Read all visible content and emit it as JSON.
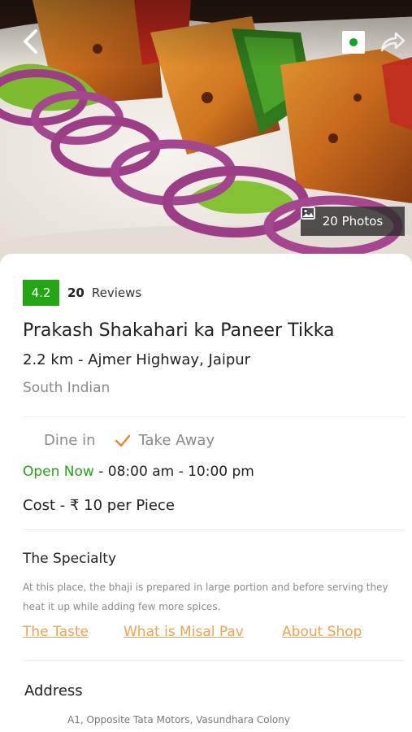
{
  "hero": {
    "back_icon": "chevron-left-icon",
    "veg_icon": "veg-indicator-icon",
    "share_icon": "share-arrow-icon",
    "photos_icon": "image-icon",
    "photos_label": "20 Photos"
  },
  "listing": {
    "rating": "4.2",
    "reviews_count": "20",
    "reviews_label": "Reviews",
    "title": "Prakash Shakahari ka Paneer Tikka",
    "location": "2.2 km - Ajmer Highway, Jaipur",
    "cuisine": "South Indian"
  },
  "services": {
    "dine_in": "Dine in",
    "check_icon": "checkmark-icon",
    "take_away": "Take Away"
  },
  "hours": {
    "status": "Open Now",
    "separator": " - ",
    "time": "08:00 am - 10:00 pm"
  },
  "cost": {
    "label": "Cost - ",
    "value": "₹ 10 per Piece"
  },
  "specialty": {
    "title": "The Specialty",
    "description": "At this place, the bhaji is prepared in large portion and before serving they heat it up while adding few more spices.",
    "links": [
      "The Taste",
      "What is Misal Pav",
      "About Shop"
    ]
  },
  "address": {
    "title": "Address",
    "line": "A1, Opposite Tata Motors, Vasundhara Colony"
  },
  "colors": {
    "rating_green": "#23a514",
    "open_green": "#23a514",
    "link_orange": "#f0a24e",
    "check_orange": "#f0862c"
  }
}
